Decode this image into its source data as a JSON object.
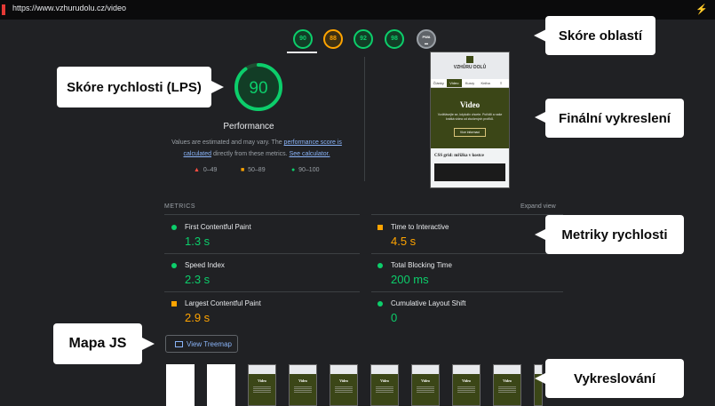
{
  "browser": {
    "url": "https://www.vzhurudolu.cz/video"
  },
  "categories": [
    {
      "score": "90",
      "color": "green"
    },
    {
      "score": "88",
      "color": "orange"
    },
    {
      "score": "92",
      "color": "green"
    },
    {
      "score": "98",
      "color": "green"
    },
    {
      "score": "PWA",
      "color": "gray"
    }
  ],
  "performance": {
    "score": "90",
    "score_value": 0.9,
    "title": "Performance",
    "desc_prefix": "Values are estimated and may vary. The ",
    "desc_link1": "performance score is calculated",
    "desc_mid": " directly from these metrics. ",
    "desc_link2": "See calculator.",
    "legend": [
      "0–49",
      "50–89",
      "90–100"
    ]
  },
  "screenshot": {
    "logo_text": "VZHŮRU DOLŮ",
    "tabs": [
      "Články",
      "Video",
      "Kurzy",
      "Kniha",
      "≡"
    ],
    "hero_title": "Video",
    "hero_desc": "Vzdělávejte se, kdykoliv chcete. Pořídili a naše krátká videa od zkušených profíků.",
    "hero_button": "Více informací",
    "section_title": "CSS grid: mřížka v kostce"
  },
  "metrics": {
    "label": "METRICS",
    "expand": "Expand view",
    "items": [
      {
        "name": "First Contentful Paint",
        "value": "1.3 s",
        "status": "green"
      },
      {
        "name": "Time to Interactive",
        "value": "4.5 s",
        "status": "orange"
      },
      {
        "name": "Speed Index",
        "value": "2.3 s",
        "status": "green"
      },
      {
        "name": "Total Blocking Time",
        "value": "200 ms",
        "status": "green"
      },
      {
        "name": "Largest Contentful Paint",
        "value": "2.9 s",
        "status": "orange"
      },
      {
        "name": "Cumulative Layout Shift",
        "value": "0",
        "status": "green"
      }
    ]
  },
  "treemap": {
    "label": "View Treemap"
  },
  "filmstrip": {
    "frame_title": "Video"
  },
  "callouts": {
    "areas": "Skóre oblastí",
    "lps": "Skóre rychlosti (LPS)",
    "final": "Finální vykreslení",
    "metrics": "Metriky rychlosti",
    "js": "Mapa JS",
    "render": "Vykreslování"
  }
}
